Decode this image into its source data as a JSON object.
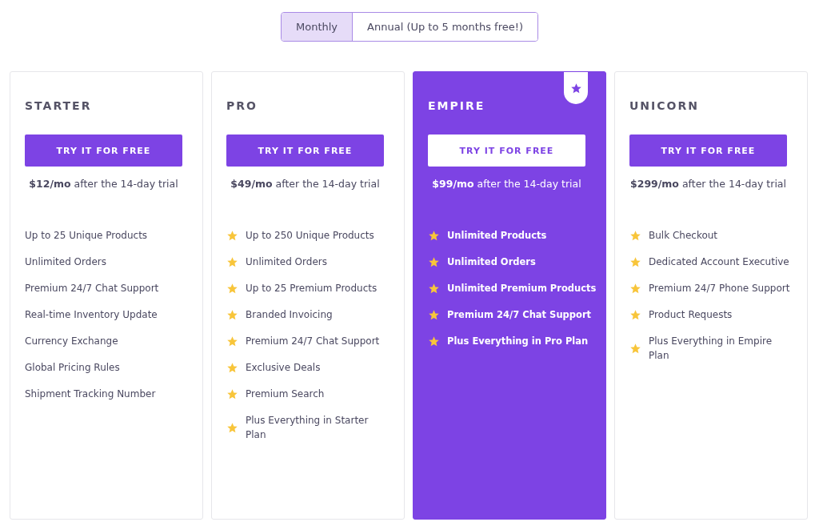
{
  "billing_toggle": [
    {
      "label": "Monthly",
      "selected": true
    },
    {
      "label": "Annual (Up to 5 months free!)",
      "selected": false
    }
  ],
  "plans": [
    {
      "name": "STARTER",
      "featured": false,
      "button": "TRY IT FOR FREE",
      "price": "**$12/mo** after the 14-day trial",
      "features": [
        {
          "text": "Up to 25 Unique Products",
          "starred": false
        },
        {
          "text": "Unlimited Orders",
          "starred": false
        },
        {
          "text": "Premium 24/7 Chat Support",
          "starred": false
        },
        {
          "text": "Real-time Inventory Update",
          "starred": false
        },
        {
          "text": "Currency Exchange",
          "starred": false
        },
        {
          "text": "Global Pricing Rules",
          "starred": false
        },
        {
          "text": "Shipment Tracking Number",
          "starred": false
        }
      ]
    },
    {
      "name": "PRO",
      "featured": false,
      "button": "TRY IT FOR FREE",
      "price": "**$49/mo** after the 14-day trial",
      "features": [
        {
          "text": "Up to 250 Unique Products",
          "starred": true
        },
        {
          "text": "Unlimited Orders",
          "starred": true
        },
        {
          "text": "Up to 25 Premium Products",
          "starred": true
        },
        {
          "text": "Branded Invoicing",
          "starred": true
        },
        {
          "text": "Premium 24/7 Chat Support",
          "starred": true
        },
        {
          "text": "Exclusive Deals",
          "starred": true
        },
        {
          "text": "Premium Search",
          "starred": true
        },
        {
          "text": "Plus Everything in Starter Plan",
          "starred": true
        }
      ]
    },
    {
      "name": "EMPIRE",
      "featured": true,
      "button": "TRY IT FOR FREE",
      "price": "**$99/mo** after the 14-day trial",
      "features": [
        {
          "text": "Unlimited Products",
          "starred": true
        },
        {
          "text": "Unlimited Orders",
          "starred": true
        },
        {
          "text": "Unlimited Premium Products",
          "starred": true
        },
        {
          "text": "Premium 24/7 Chat Support",
          "starred": true
        },
        {
          "text": "Plus Everything in Pro Plan",
          "starred": true
        }
      ]
    },
    {
      "name": "UNICORN",
      "featured": false,
      "button": "TRY IT FOR FREE",
      "price": "**$299/mo** after the 14-day trial",
      "features": [
        {
          "text": "Bulk Checkout",
          "starred": true
        },
        {
          "text": "Dedicated Account Executive",
          "starred": true
        },
        {
          "text": "Premium 24/7 Phone Support",
          "starred": true
        },
        {
          "text": "Product Requests",
          "starred": true
        },
        {
          "text": "Plus Everything in Empire Plan",
          "starred": true
        }
      ]
    }
  ]
}
